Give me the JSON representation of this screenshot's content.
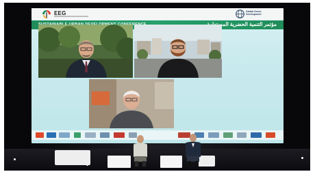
{
  "image": {
    "subject": "conference-stage-with-video-panel",
    "event_logo_text": "EEG",
    "banner_english": "SUSTAINABLE URBAN DEVELOPMENT CONFERENCE",
    "banner_arabic": "مؤتمر التنمية الحضرية المستدامة",
    "partner_logo_text": "Global Green Development",
    "colors": {
      "banner_green": "#27a06a",
      "screen_bg": "#cdeaee",
      "stage_black": "#08080a"
    }
  }
}
